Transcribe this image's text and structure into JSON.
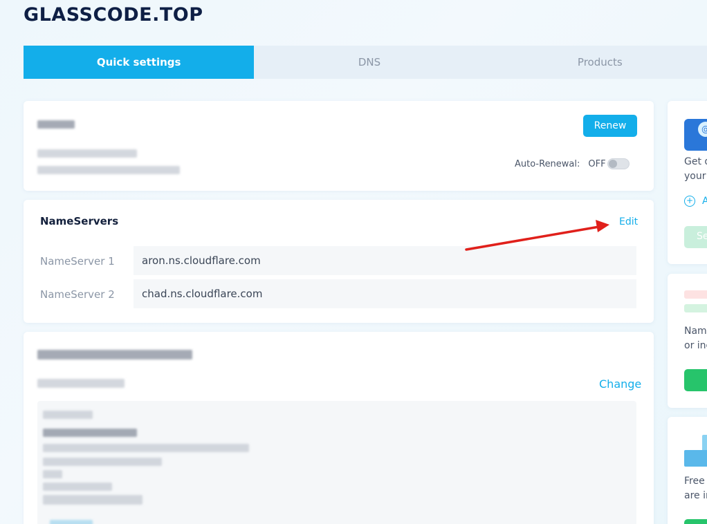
{
  "domain": "GLASSCODE.TOP",
  "tabs": [
    {
      "label": "Quick settings",
      "active": true
    },
    {
      "label": "DNS",
      "active": false
    },
    {
      "label": "Products",
      "active": false
    }
  ],
  "renewal": {
    "renew_label": "Renew",
    "auto_renewal_label": "Auto-Renewal:",
    "auto_renewal_state": "OFF"
  },
  "nameservers": {
    "title": "NameServers",
    "edit_label": "Edit",
    "rows": [
      {
        "label": "NameServer 1",
        "value": "aron.ns.cloudflare.com"
      },
      {
        "label": "NameServer 2",
        "value": "chad.ns.cloudflare.com"
      }
    ]
  },
  "contact": {
    "change_label": "Change"
  },
  "sidebar": {
    "card1": {
      "line1": "Get d",
      "line2": "your l",
      "link": "A",
      "button": "Se"
    },
    "card2": {
      "line1": "Name",
      "line2": "or inc"
    },
    "card3": {
      "line1": "Free c",
      "line2": "are in"
    }
  },
  "colors": {
    "accent": "#13aeea",
    "green": "#27c46b",
    "title": "#0e1f45",
    "annotation_arrow": "#e0201b"
  }
}
